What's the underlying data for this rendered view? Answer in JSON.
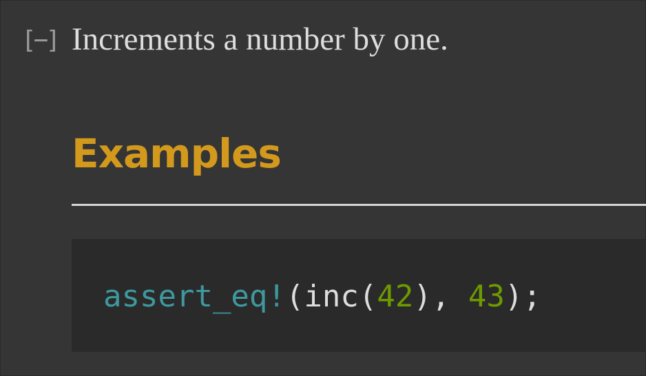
{
  "toggle": {
    "label": "[−]"
  },
  "docblock": {
    "summary": "Increments a number by one.",
    "section_heading": "Examples"
  },
  "code": {
    "tokens": {
      "macro": "assert_eq!",
      "open_paren": "(",
      "fn_name": "inc",
      "fn_open": "(",
      "arg": "42",
      "fn_close": ")",
      "comma": ", ",
      "expected": "43",
      "close": ");"
    },
    "colors": {
      "macro": "#3e999f",
      "number": "#6e9a00",
      "plain": "#dddddd"
    }
  },
  "theme": {
    "background": "#353535",
    "code_background": "#2a2a2a",
    "heading_color": "#d2991d",
    "text_color": "#dddddd",
    "rule_color": "#d6d6d6"
  }
}
